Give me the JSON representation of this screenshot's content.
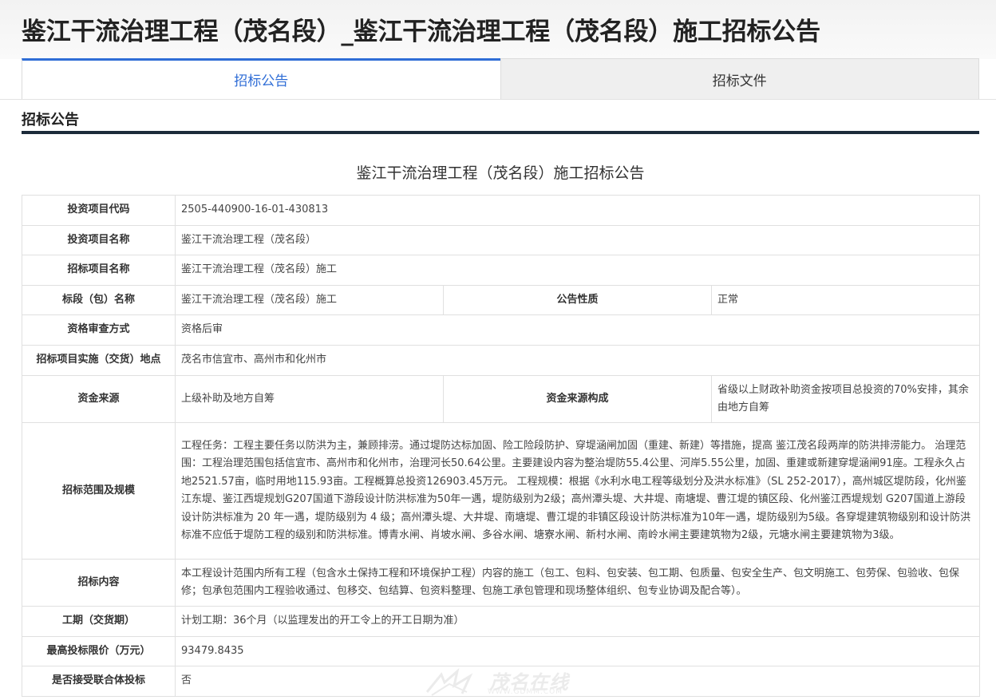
{
  "page": {
    "title": "鉴江干流治理工程（茂名段）_鉴江干流治理工程（茂名段）施工招标公告"
  },
  "tabs": [
    {
      "label": "招标公告",
      "active": true
    },
    {
      "label": "招标文件",
      "active": false
    }
  ],
  "section": {
    "title": "招标公告"
  },
  "notice": {
    "title": "鉴江干流治理工程（茂名段）施工招标公告",
    "rows": {
      "project_code": {
        "label": "投资项目代码",
        "value": "2505-440900-16-01-430813"
      },
      "project_name": {
        "label": "投资项目名称",
        "value": "鉴江干流治理工程（茂名段）"
      },
      "bid_project_name": {
        "label": "招标项目名称",
        "value": "鉴江干流治理工程（茂名段）施工"
      },
      "section_name": {
        "label": "标段（包）名称",
        "value": "鉴江干流治理工程（茂名段）施工",
        "label2": "公告性质",
        "value2": "正常"
      },
      "qualification": {
        "label": "资格审查方式",
        "value": "资格后审"
      },
      "location": {
        "label": "招标项目实施（交货）地点",
        "value": "茂名市信宜市、高州市和化州市"
      },
      "funding": {
        "label": "资金来源",
        "value": "上级补助及地方自筹",
        "label2": "资金来源构成",
        "value2": "省级以上财政补助资金按项目总投资的70%安排，其余由地方自筹"
      },
      "scope": {
        "label": "招标范围及规模",
        "value": "工程任务：工程主要任务以防洪为主，兼顾排涝。通过堤防达标加固、险工险段防护、穿堤涵闸加固（重建、新建）等措施，提高 鉴江茂名段两岸的防洪排涝能力。 治理范围：工程治理范围包括信宜市、高州市和化州市，治理河长50.64公里。主要建设内容为整治堤防55.4公里、河岸5.55公里，加固、重建或新建穿堤涵闸91座。工程永久占地2521.57亩，临时用地115.93亩。工程概算总投资126903.45万元。 工程规模：根据《水利水电工程等级划分及洪水标准》（SL 252-2017），高州城区堤防段，化州鉴江东堤、鉴江西堤规划G207国道下游段设计防洪标准为50年一遇，堤防级别为2级；高州潭头堤、大井堤、南塘堤、曹江堤的镇区段、化州鉴江西堤规划 G207国道上游段设计防洪标准为 20 年一遇，堤防级别为 4 级；高州潭头堤、大井堤、南塘堤、曹江堤的非镇区段设计防洪标准为10年一遇，堤防级别为5级。各穿堤建筑物级别和设计防洪标准不应低于堤防工程的级别和防洪标准。博青水闸、肖坡水闸、多谷水闸、塘寮水闸、新村水闸、南岭水闸主要建筑物为2级，元塘水闸主要建筑物为3级。"
      },
      "content": {
        "label": "招标内容",
        "value": "本工程设计范围内所有工程（包含水土保持工程和环境保护工程）内容的施工（包工、包料、包安装、包工期、包质量、包安全生产、包文明施工、包劳保、包验收、包保修；包承包范围内工程验收通过、包移交、包结算、包资料整理、包施工承包管理和现场整体组织、包专业协调及配合等）。"
      },
      "period": {
        "label": "工期（交货期）",
        "value": "计划工期：36个月（以监理发出的开工令上的开工日期为准）"
      },
      "max_price": {
        "label": "最高投标限价（万元）",
        "value": "93479.8435"
      },
      "consortium": {
        "label": "是否接受联合体投标",
        "value": "否"
      }
    }
  },
  "watermark": {
    "text": "茂名在线",
    "url": "WWW.GDMM.COM"
  },
  "colors": {
    "accent": "#2f6dd6",
    "section_rule": "#1c2b3a",
    "border": "#e0e0e0",
    "tab_inactive_bg": "#efefef"
  }
}
